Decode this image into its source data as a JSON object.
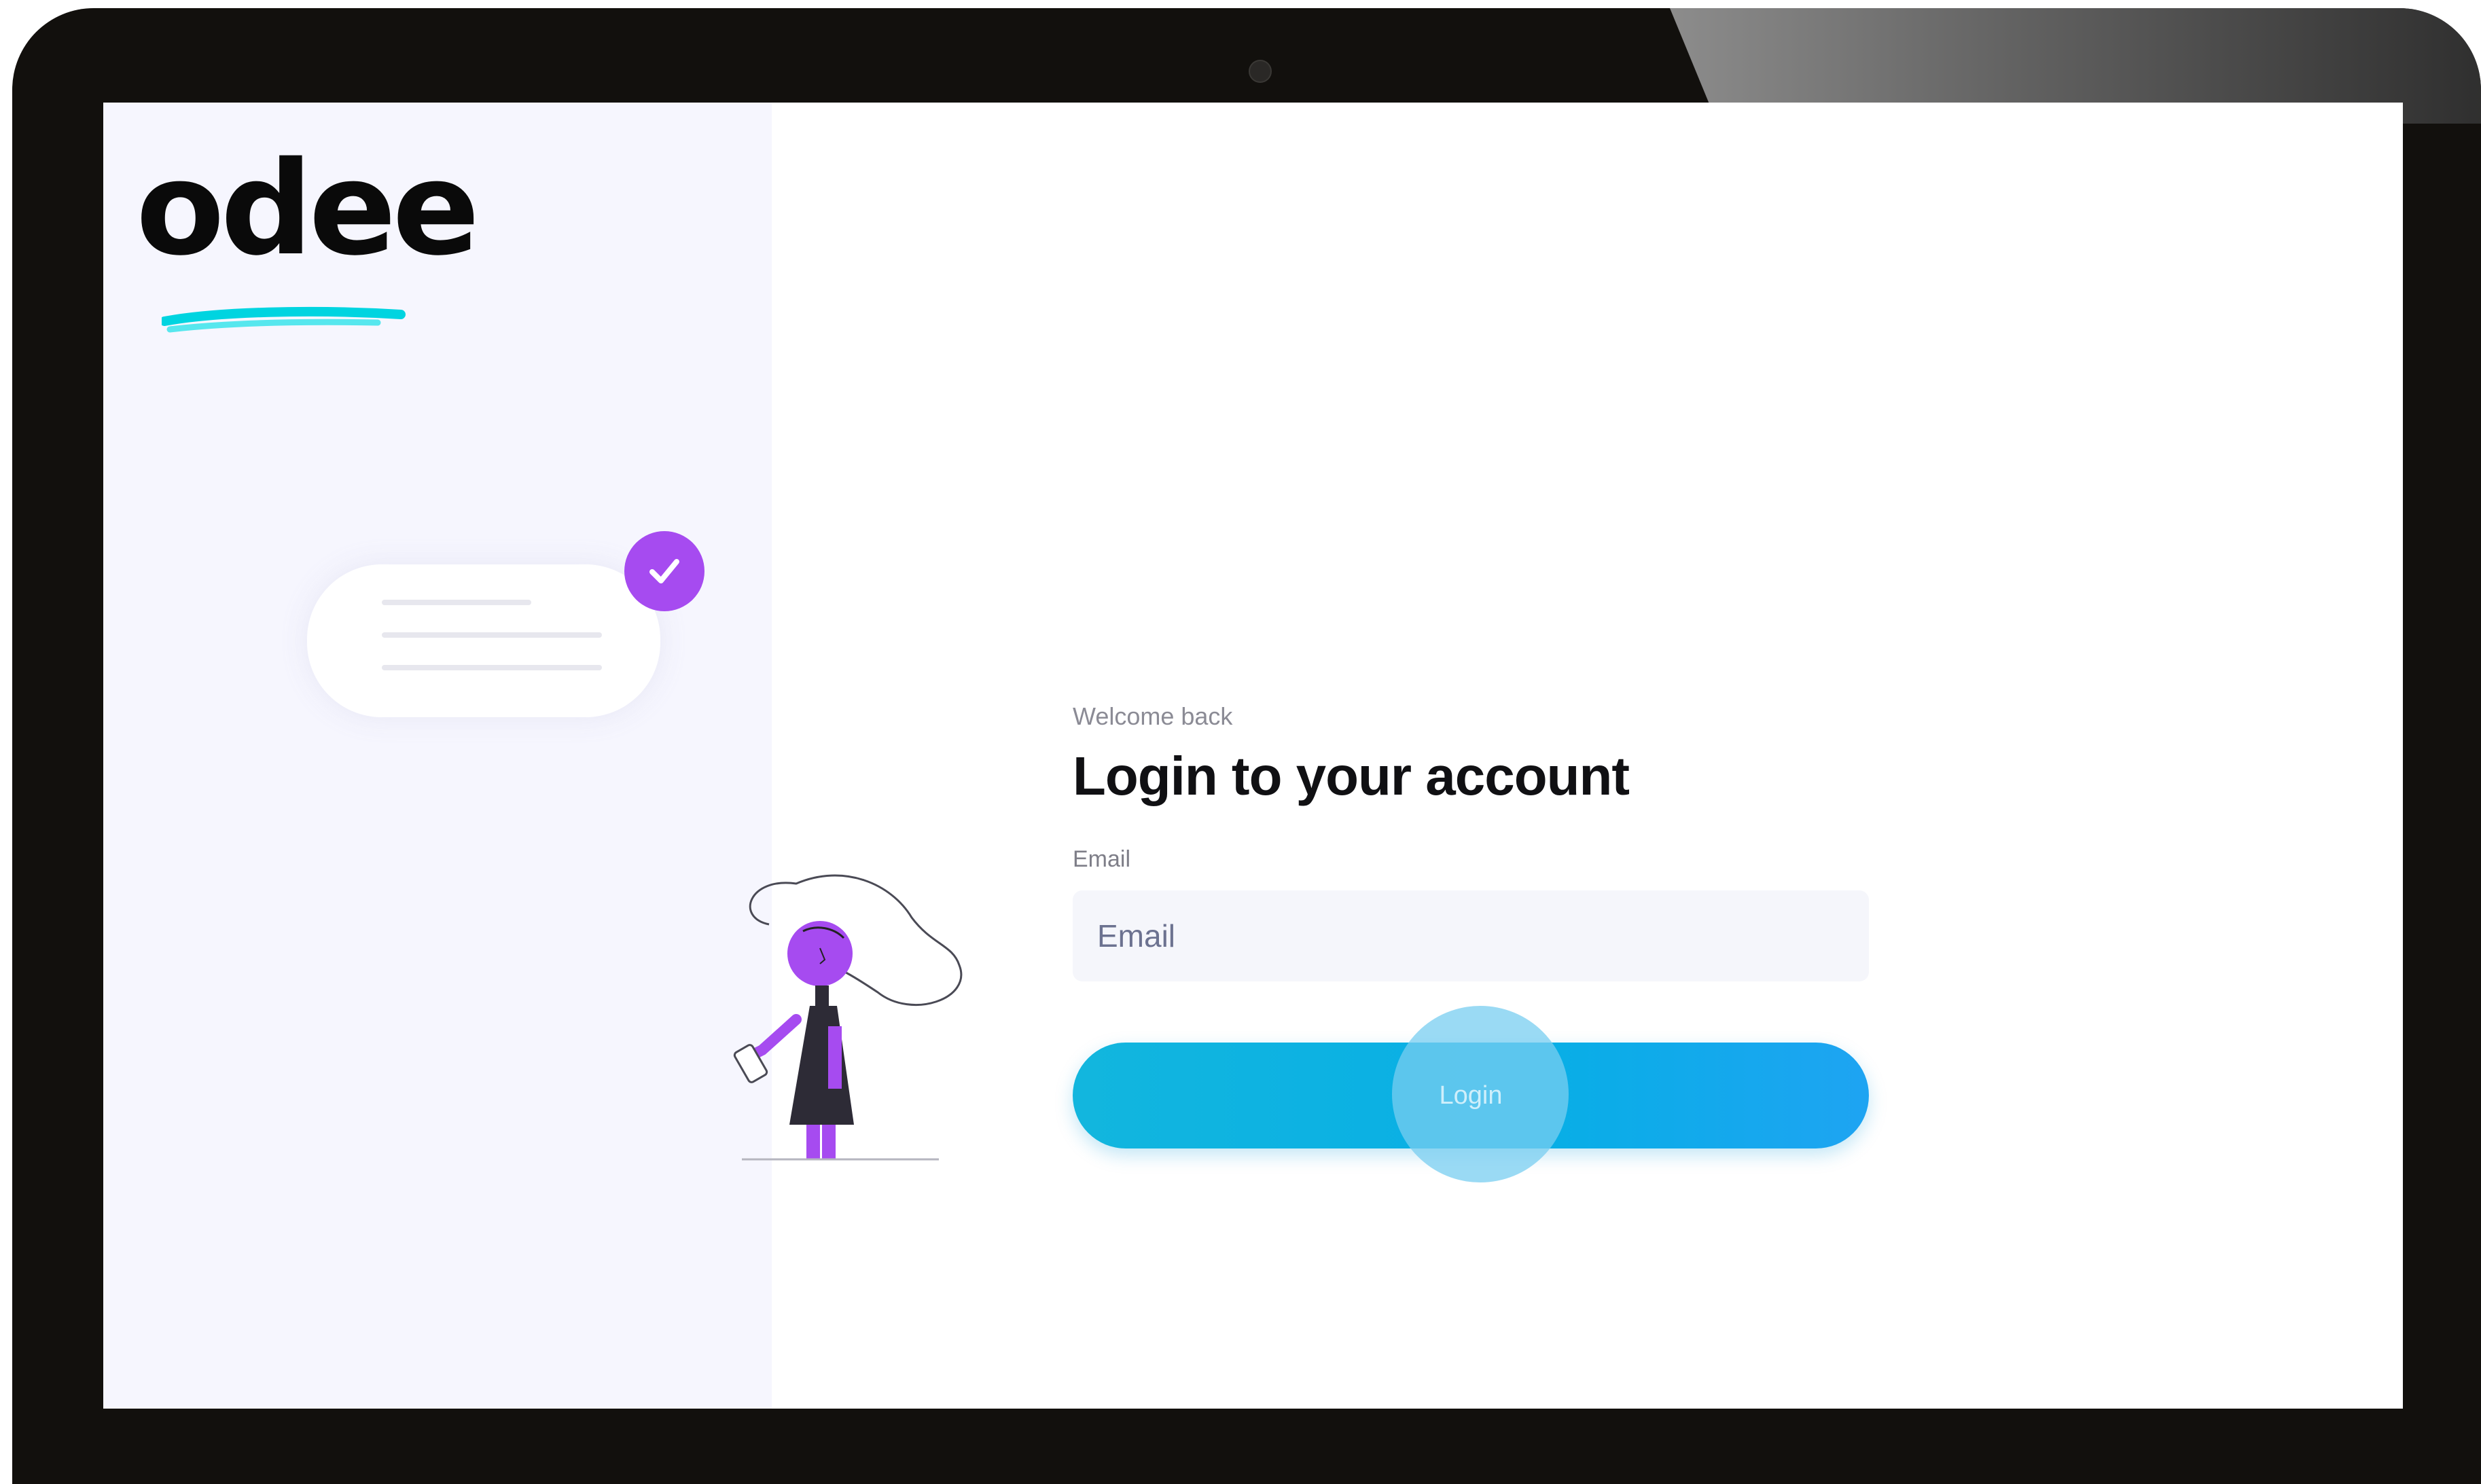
{
  "brand": {
    "logo_text": "odee",
    "accent_color": "#00d4e0"
  },
  "colors": {
    "primary": "#08aee6",
    "badge": "#a64bf0",
    "left_panel_bg": "#f6f6fe"
  },
  "icons": {
    "badge": "check-icon"
  },
  "login_form": {
    "welcome": "Welcome back",
    "title": "Login to your account",
    "email_label": "Email",
    "email_placeholder": "Email",
    "email_value": "",
    "login_label": "Login"
  }
}
